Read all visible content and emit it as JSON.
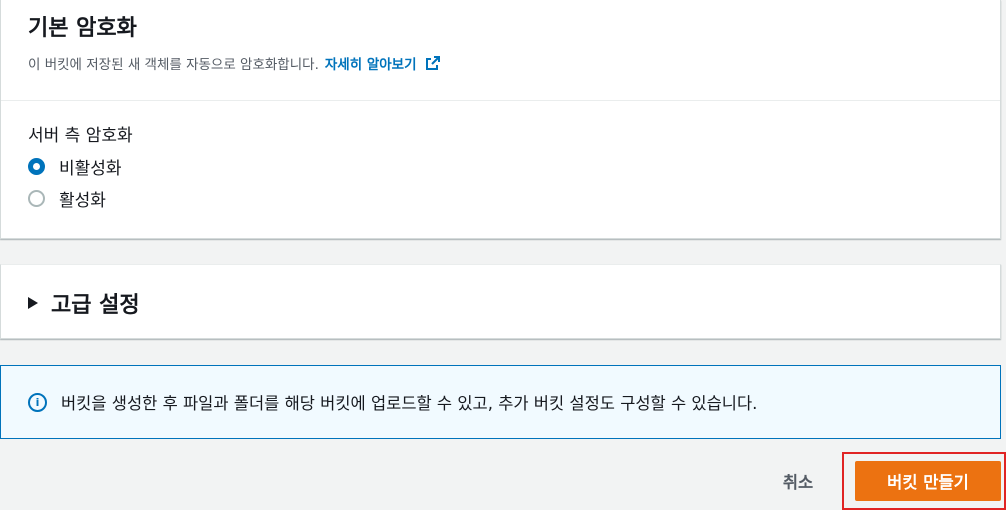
{
  "encryption": {
    "title": "기본 암호화",
    "description": "이 버킷에 저장된 새 객체를 자동으로 암호화합니다.",
    "learn_more": "자세히 알아보기",
    "icon": "external-link-icon",
    "field_label": "서버 측 암호화",
    "options": [
      {
        "label": "비활성화",
        "selected": true
      },
      {
        "label": "활성화",
        "selected": false
      }
    ]
  },
  "advanced": {
    "title": "고급 설정",
    "expanded": false
  },
  "info": {
    "icon": "info-icon",
    "text": "버킷을 생성한 후 파일과 폴더를 해당 버킷에 업로드할 수 있고, 추가 버킷 설정도 구성할 수 있습니다."
  },
  "actions": {
    "cancel_label": "취소",
    "create_label": "버킷 만들기"
  },
  "colors": {
    "accent": "#0073bb",
    "primary_button": "#ec7211",
    "highlight": "#e02424"
  }
}
